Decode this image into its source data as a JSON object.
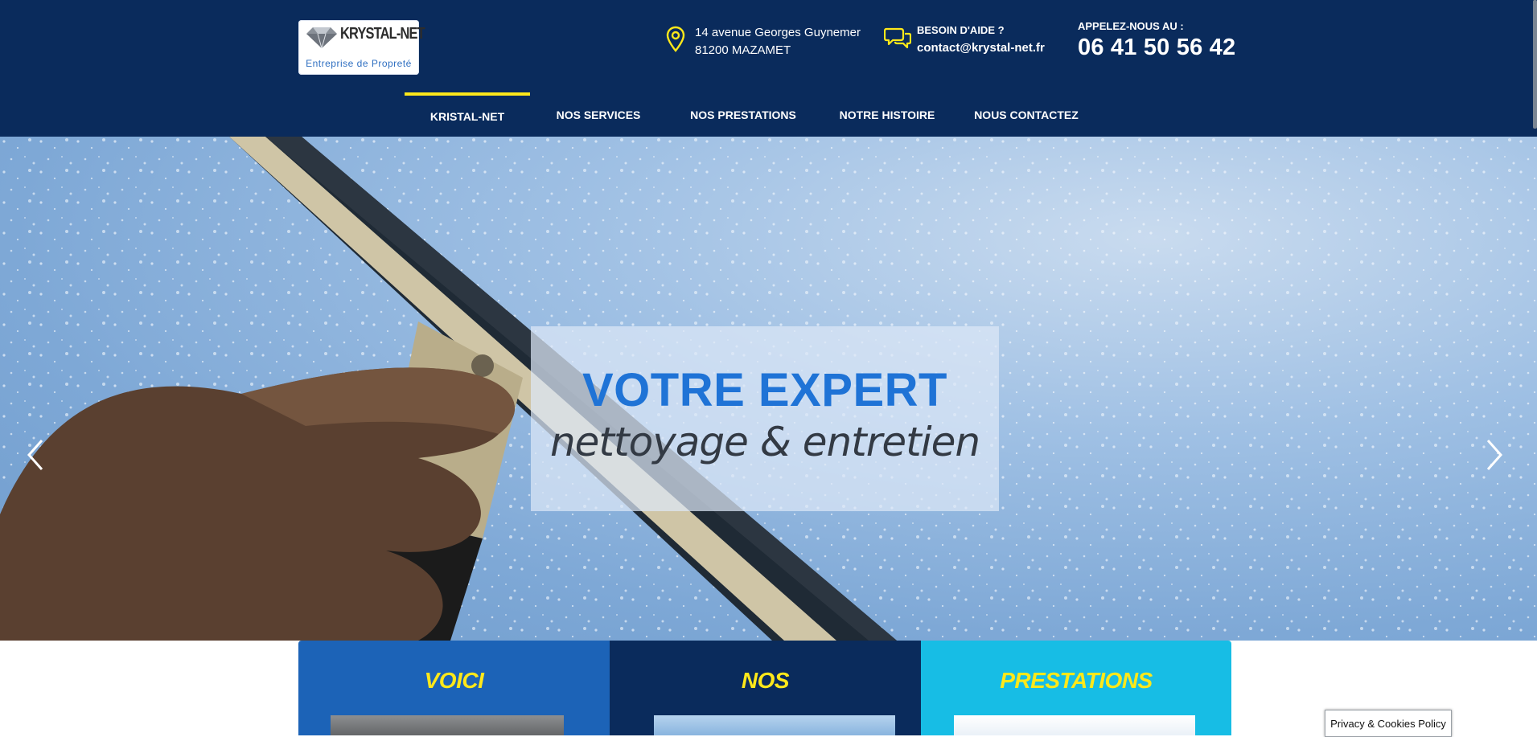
{
  "header": {
    "logo": {
      "brand": "KRYSTAL-NET",
      "tagline": "Entreprise de Propreté"
    },
    "address": {
      "line1": "14 avenue Georges Guynemer",
      "line2": "81200 MAZAMET",
      "icon": "map-pin-icon"
    },
    "help": {
      "label": "BESOIN D'AIDE ?",
      "email": "contact@krystal-net.fr",
      "icon": "chat-bubbles-icon"
    },
    "phone": {
      "label": "APPELEZ-NOUS AU :",
      "number": "06 41 50 56 42"
    }
  },
  "nav": {
    "items": [
      {
        "label": "KRISTAL-NET",
        "active": true
      },
      {
        "label": "NOS SERVICES",
        "active": false
      },
      {
        "label": "NOS PRESTATIONS",
        "active": false
      },
      {
        "label": "NOTRE HISTOIRE",
        "active": false
      },
      {
        "label": "NOUS CONTACTEZ",
        "active": false
      }
    ]
  },
  "hero": {
    "title": "VOTRE EXPERT",
    "subtitle": "nettoyage & entretien",
    "prev_icon": "chevron-left-icon",
    "next_icon": "chevron-right-icon"
  },
  "cards": [
    {
      "title": "VOICI"
    },
    {
      "title": "NOS"
    },
    {
      "title": "PRESTATIONS"
    }
  ],
  "privacy": {
    "label": "Privacy & Cookies Policy"
  },
  "colors": {
    "header_bg": "#0a2b5c",
    "accent_yellow": "#ffe81a",
    "title_blue": "#1f73d6",
    "card1": "#1c63b7",
    "card2": "#0a2b5c",
    "card3": "#17bde5"
  }
}
